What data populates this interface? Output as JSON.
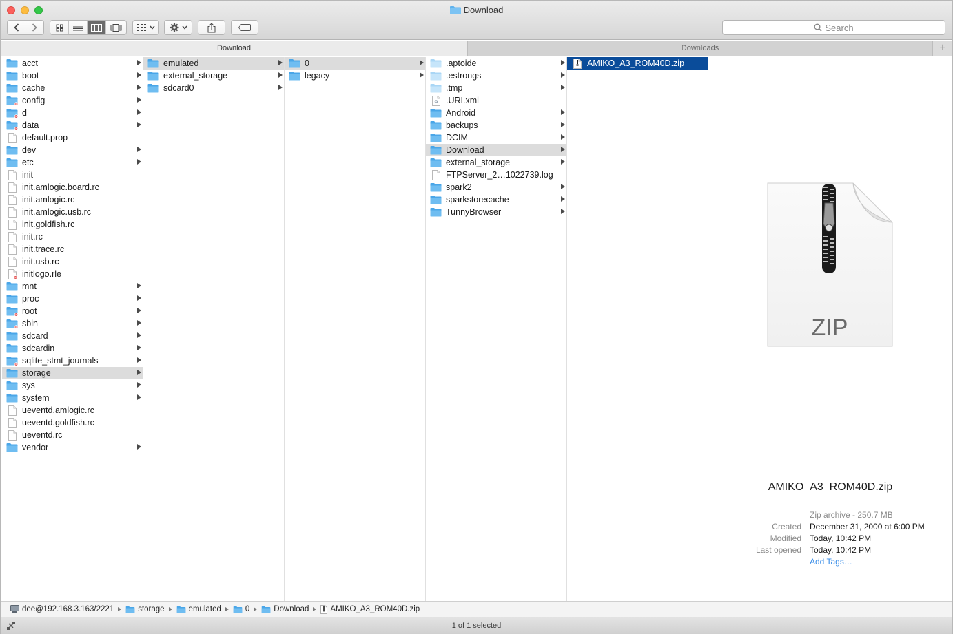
{
  "window": {
    "title": "Download"
  },
  "toolbar": {
    "search_placeholder": "Search"
  },
  "tabs": [
    {
      "label": "Download"
    },
    {
      "label": "Downloads"
    }
  ],
  "columns": [
    {
      "items": [
        {
          "name": "acct",
          "type": "folder",
          "arrow": true
        },
        {
          "name": "boot",
          "type": "folder",
          "arrow": true
        },
        {
          "name": "cache",
          "type": "folder",
          "arrow": true
        },
        {
          "name": "config",
          "type": "folder-restricted",
          "arrow": true
        },
        {
          "name": "d",
          "type": "folder-restricted",
          "arrow": true
        },
        {
          "name": "data",
          "type": "folder-restricted",
          "arrow": true
        },
        {
          "name": "default.prop",
          "type": "file",
          "arrow": false
        },
        {
          "name": "dev",
          "type": "folder",
          "arrow": true
        },
        {
          "name": "etc",
          "type": "folder",
          "arrow": true
        },
        {
          "name": "init",
          "type": "file",
          "arrow": false
        },
        {
          "name": "init.amlogic.board.rc",
          "type": "file",
          "arrow": false
        },
        {
          "name": "init.amlogic.rc",
          "type": "file",
          "arrow": false
        },
        {
          "name": "init.amlogic.usb.rc",
          "type": "file",
          "arrow": false
        },
        {
          "name": "init.goldfish.rc",
          "type": "file",
          "arrow": false
        },
        {
          "name": "init.rc",
          "type": "file",
          "arrow": false
        },
        {
          "name": "init.trace.rc",
          "type": "file",
          "arrow": false
        },
        {
          "name": "init.usb.rc",
          "type": "file",
          "arrow": false
        },
        {
          "name": "initlogo.rle",
          "type": "file-restricted",
          "arrow": false
        },
        {
          "name": "mnt",
          "type": "folder",
          "arrow": true
        },
        {
          "name": "proc",
          "type": "folder",
          "arrow": true
        },
        {
          "name": "root",
          "type": "folder-restricted",
          "arrow": true
        },
        {
          "name": "sbin",
          "type": "folder-restricted",
          "arrow": true
        },
        {
          "name": "sdcard",
          "type": "folder",
          "arrow": true
        },
        {
          "name": "sdcardin",
          "type": "folder",
          "arrow": true
        },
        {
          "name": "sqlite_stmt_journals",
          "type": "folder-restricted",
          "arrow": true
        },
        {
          "name": "storage",
          "type": "folder",
          "arrow": true,
          "selected": true
        },
        {
          "name": "sys",
          "type": "folder",
          "arrow": true
        },
        {
          "name": "system",
          "type": "folder",
          "arrow": true
        },
        {
          "name": "ueventd.amlogic.rc",
          "type": "file",
          "arrow": false
        },
        {
          "name": "ueventd.goldfish.rc",
          "type": "file",
          "arrow": false
        },
        {
          "name": "ueventd.rc",
          "type": "file",
          "arrow": false
        },
        {
          "name": "vendor",
          "type": "folder",
          "arrow": true
        }
      ]
    },
    {
      "items": [
        {
          "name": "emulated",
          "type": "folder",
          "arrow": true,
          "selected": true
        },
        {
          "name": "external_storage",
          "type": "folder",
          "arrow": true
        },
        {
          "name": "sdcard0",
          "type": "folder",
          "arrow": true
        }
      ]
    },
    {
      "items": [
        {
          "name": "0",
          "type": "folder",
          "arrow": true,
          "selected": true
        },
        {
          "name": "legacy",
          "type": "folder",
          "arrow": true
        }
      ]
    },
    {
      "items": [
        {
          "name": ".aptoide",
          "type": "folder-light",
          "arrow": true
        },
        {
          "name": ".estrongs",
          "type": "folder-light",
          "arrow": true
        },
        {
          "name": ".tmp",
          "type": "folder-light",
          "arrow": true
        },
        {
          "name": ".URI.xml",
          "type": "file-gear",
          "arrow": false
        },
        {
          "name": "Android",
          "type": "folder",
          "arrow": true
        },
        {
          "name": "backups",
          "type": "folder",
          "arrow": true
        },
        {
          "name": "DCIM",
          "type": "folder",
          "arrow": true
        },
        {
          "name": "Download",
          "type": "folder",
          "arrow": true,
          "selected": true
        },
        {
          "name": "external_storage",
          "type": "folder",
          "arrow": true
        },
        {
          "name": "FTPServer_2…1022739.log",
          "type": "file",
          "arrow": false
        },
        {
          "name": "spark2",
          "type": "folder",
          "arrow": true
        },
        {
          "name": "sparkstorecache",
          "type": "folder",
          "arrow": true
        },
        {
          "name": "TunnyBrowser",
          "type": "folder",
          "arrow": true
        }
      ]
    },
    {
      "items": [
        {
          "name": "AMIKO_A3_ROM40D.zip",
          "type": "file-zip",
          "arrow": false,
          "selected": true,
          "active": true
        }
      ]
    }
  ],
  "preview": {
    "icon_label": "ZIP",
    "filename": "AMIKO_A3_ROM40D.zip",
    "kind": "Zip archive - 250.7 MB",
    "created_label": "Created",
    "created": "December 31, 2000 at 6:00 PM",
    "modified_label": "Modified",
    "modified": "Today, 10:42 PM",
    "opened_label": "Last opened",
    "opened": "Today, 10:42 PM",
    "add_tags": "Add Tags…"
  },
  "pathbar": [
    {
      "label": "dee@192.168.3.163/2221",
      "icon": "server"
    },
    {
      "label": "storage",
      "icon": "folder"
    },
    {
      "label": "emulated",
      "icon": "folder"
    },
    {
      "label": "0",
      "icon": "folder"
    },
    {
      "label": "Download",
      "icon": "folder"
    },
    {
      "label": "AMIKO_A3_ROM40D.zip",
      "icon": "file"
    }
  ],
  "status": {
    "text": "1 of 1 selected"
  },
  "colors": {
    "folder": "#5fb2ec",
    "selection": "#0a4c9a",
    "link": "#3b8ee8"
  }
}
